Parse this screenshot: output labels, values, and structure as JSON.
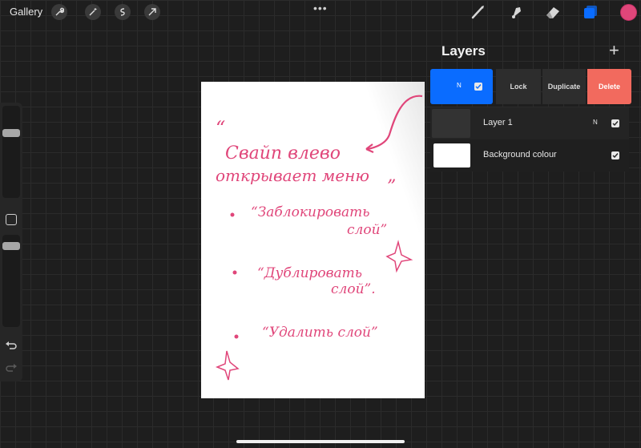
{
  "topbar": {
    "gallery_label": "Gallery",
    "actions_tools": [
      "wrench-icon",
      "magic-wand-icon",
      "selection-icon",
      "transform-arrow-icon"
    ],
    "more_label": "•••",
    "right_tools": [
      "brush-icon",
      "smudge-icon",
      "eraser-icon",
      "layers-icon"
    ],
    "current_color": "#e0467a",
    "accent_color": "#0a6cff"
  },
  "sidebar": {
    "brush_size_label": "brush-size-slider",
    "opacity_label": "opacity-slider",
    "undo_icon": "undo-icon",
    "redo_icon": "redo-icon"
  },
  "canvas": {
    "text_color": "#e0467a",
    "lines": [
      "“",
      "Свайп влево",
      "открывает меню",
      "”",
      "“Заблокировать",
      "слой”",
      "“Дублировать",
      "слой”.",
      "“Удалить слой”"
    ]
  },
  "layers_panel": {
    "title": "Layers",
    "add_label": "+",
    "active_layer_blend": "N",
    "actions": {
      "lock": "Lock",
      "duplicate": "Duplicate",
      "delete": "Delete"
    },
    "delete_color": "#f26a5e",
    "layers": [
      {
        "name": "Layer 1",
        "blend": "N",
        "visible": true
      },
      {
        "name": "Background colour",
        "blend": "",
        "visible": true
      }
    ]
  }
}
